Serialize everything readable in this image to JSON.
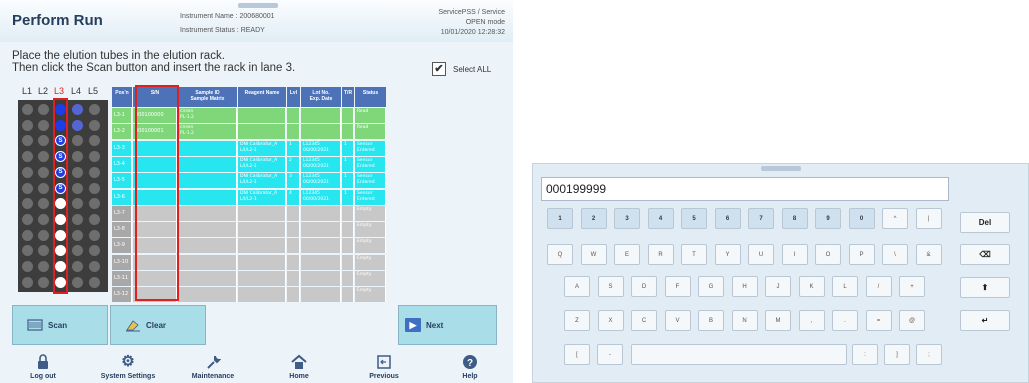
{
  "header": {
    "title": "Perform Run",
    "instrument_name": "Instrument Name : 200680001",
    "instrument_status": "Instrument Status : READY",
    "user": "ServicePSS / Service",
    "mode": "OPEN mode",
    "datetime": "10/01/2020 12:28:32"
  },
  "instructions": {
    "line1": "Place the elution tubes in the elution rack.",
    "line2": "Then click the Scan button and insert the rack in lane 3."
  },
  "select_all": {
    "label": "Select ALL",
    "checked": "✔"
  },
  "rack": {
    "lanes": [
      "L1",
      "L2",
      "L3",
      "L4",
      "L5"
    ],
    "highlight_lane": "L3",
    "l3_tubes": [
      "blue",
      "blue",
      "S",
      "S",
      "S",
      "S",
      "white",
      "white",
      "white",
      "white",
      "white",
      "white"
    ],
    "colors": {
      "blue": "#1c3ee6",
      "white": "#ffffff",
      "empty": "#6e6e6e",
      "lane_highlight": "#e02020"
    }
  },
  "table": {
    "headers": [
      "Pos'n",
      "S/N",
      "Sample ID\nSample Matrix",
      "Reagent Name",
      "Lvl",
      "Lot No.\nExp. Date",
      "T/R",
      "Status"
    ],
    "rows": [
      {
        "pos": "L3-1",
        "sn": "000100000",
        "sample": "cnsen\nPL-1.2",
        "reagent": "",
        "lvl": "",
        "lot": "",
        "tr": "",
        "status": "Read",
        "color": "#7fd77a"
      },
      {
        "pos": "L3-2",
        "sn": "000100001",
        "sample": "cnsen\nPL-1.2",
        "reagent": "",
        "lvl": "",
        "lot": "",
        "tr": "",
        "status": "Read",
        "color": "#7fd77a"
      },
      {
        "pos": "L3-3",
        "sn": "",
        "sample": "",
        "reagent": "DNI Calibrator_A\nL/I/L2-1",
        "lvl": "1",
        "lot": "L12345\n00/00/2021",
        "tr": "1",
        "status": "Sensor\nEntered",
        "color": "#27e6f0"
      },
      {
        "pos": "L3-4",
        "sn": "",
        "sample": "",
        "reagent": "DNI Calibrator_A\nL/I/L2-1",
        "lvl": "2",
        "lot": "L12345\n00/00/2021",
        "tr": "1",
        "status": "Sensor\nEntered",
        "color": "#27e6f0"
      },
      {
        "pos": "L3-5",
        "sn": "",
        "sample": "",
        "reagent": "DNI Calibrator_A\nL/I/L2-1",
        "lvl": "3",
        "lot": "L12345\n00/00/2021",
        "tr": "1",
        "status": "Sensor\nEntered",
        "color": "#27e6f0"
      },
      {
        "pos": "L3-6",
        "sn": "",
        "sample": "",
        "reagent": "DNI Calibrator_A\nL/I/L2-1",
        "lvl": "4",
        "lot": "L12345\n00/00/2021",
        "tr": "1",
        "status": "Sensor\nEntered",
        "color": "#27e6f0"
      },
      {
        "pos": "L3-7",
        "sn": "",
        "sample": "",
        "reagent": "",
        "lvl": "",
        "lot": "",
        "tr": "",
        "status": "Empty",
        "color": "#c8c8c8"
      },
      {
        "pos": "L3-8",
        "sn": "",
        "sample": "",
        "reagent": "",
        "lvl": "",
        "lot": "",
        "tr": "",
        "status": "Empty",
        "color": "#c8c8c8"
      },
      {
        "pos": "L3-9",
        "sn": "",
        "sample": "",
        "reagent": "",
        "lvl": "",
        "lot": "",
        "tr": "",
        "status": "Empty",
        "color": "#c8c8c8"
      },
      {
        "pos": "L3-10",
        "sn": "",
        "sample": "",
        "reagent": "",
        "lvl": "",
        "lot": "",
        "tr": "",
        "status": "Empty",
        "color": "#c8c8c8"
      },
      {
        "pos": "L3-11",
        "sn": "",
        "sample": "",
        "reagent": "",
        "lvl": "",
        "lot": "",
        "tr": "",
        "status": "Empty",
        "color": "#c8c8c8"
      },
      {
        "pos": "L3-12",
        "sn": "",
        "sample": "",
        "reagent": "",
        "lvl": "",
        "lot": "",
        "tr": "",
        "status": "Empty",
        "color": "#c8c8c8"
      }
    ]
  },
  "buttons": {
    "scan": "Scan",
    "clear": "Clear",
    "next": "Next"
  },
  "nav": [
    {
      "label": "Log out",
      "icon": "logout-icon"
    },
    {
      "label": "System Settings",
      "icon": "gear-icon"
    },
    {
      "label": "Maintenance",
      "icon": "wrench-icon"
    },
    {
      "label": "Home",
      "icon": "home-icon"
    },
    {
      "label": "Previous",
      "icon": "previous-icon"
    },
    {
      "label": "Help",
      "icon": "help-icon"
    }
  ],
  "keyboard": {
    "input_value": "000199999",
    "row1": [
      "1",
      "2",
      "3",
      "4",
      "5",
      "6",
      "7",
      "8",
      "9",
      "0",
      "^",
      "|"
    ],
    "row2": [
      "Q",
      "W",
      "E",
      "R",
      "T",
      "Y",
      "U",
      "I",
      "O",
      "P",
      "\\",
      "&"
    ],
    "row3": [
      "A",
      "S",
      "D",
      "F",
      "G",
      "H",
      "J",
      "K",
      "L",
      "/",
      "+"
    ],
    "row4": [
      "Z",
      "X",
      "C",
      "V",
      "B",
      "N",
      "M",
      ",",
      ".",
      "=",
      "@"
    ],
    "row5": [
      "[",
      "-",
      "",
      ":",
      "]",
      ";"
    ],
    "side": {
      "del": "Del",
      "backspace": "⌫",
      "shift": "⬆",
      "enter": "↵"
    }
  }
}
